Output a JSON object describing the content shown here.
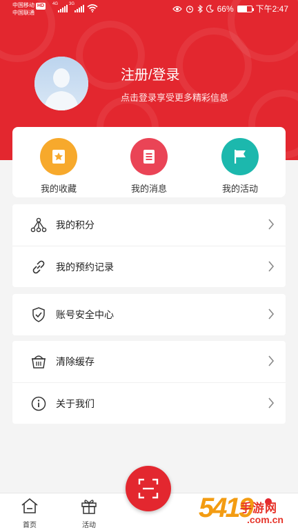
{
  "status_bar": {
    "carrier_1": "中国移动",
    "hd": "HD",
    "carrier_2": "中国联通",
    "net_1": "4G",
    "net_2": "3G",
    "battery_text": "66%",
    "battery_level": 0.66,
    "time": "下午2:47"
  },
  "profile": {
    "login_title": "注册/登录",
    "login_subtitle": "点击登录享受更多精彩信息"
  },
  "quick_actions": [
    {
      "label": "我的收藏",
      "icon": "star-bookmark-icon",
      "color": "#f7a92c"
    },
    {
      "label": "我的消息",
      "icon": "message-list-icon",
      "color": "#ea4456"
    },
    {
      "label": "我的活动",
      "icon": "flag-icon",
      "color": "#1cb8ad"
    }
  ],
  "menu_group_1": [
    {
      "label": "我的积分",
      "icon": "points-tree-icon"
    },
    {
      "label": "我的预约记录",
      "icon": "link-icon"
    }
  ],
  "menu_group_2": [
    {
      "label": "账号安全中心",
      "icon": "shield-check-icon"
    }
  ],
  "menu_group_3": [
    {
      "label": "清除缓存",
      "icon": "basket-icon"
    },
    {
      "label": "关于我们",
      "icon": "info-icon"
    }
  ],
  "bottom_nav": {
    "home_label": "首页",
    "activity_label": "活动"
  },
  "watermark": {
    "number": "5419",
    "title": "手游网",
    "domain": ".com.cn"
  },
  "colors": {
    "brand_red": "#e3272f",
    "background": "#f4f4f4"
  }
}
